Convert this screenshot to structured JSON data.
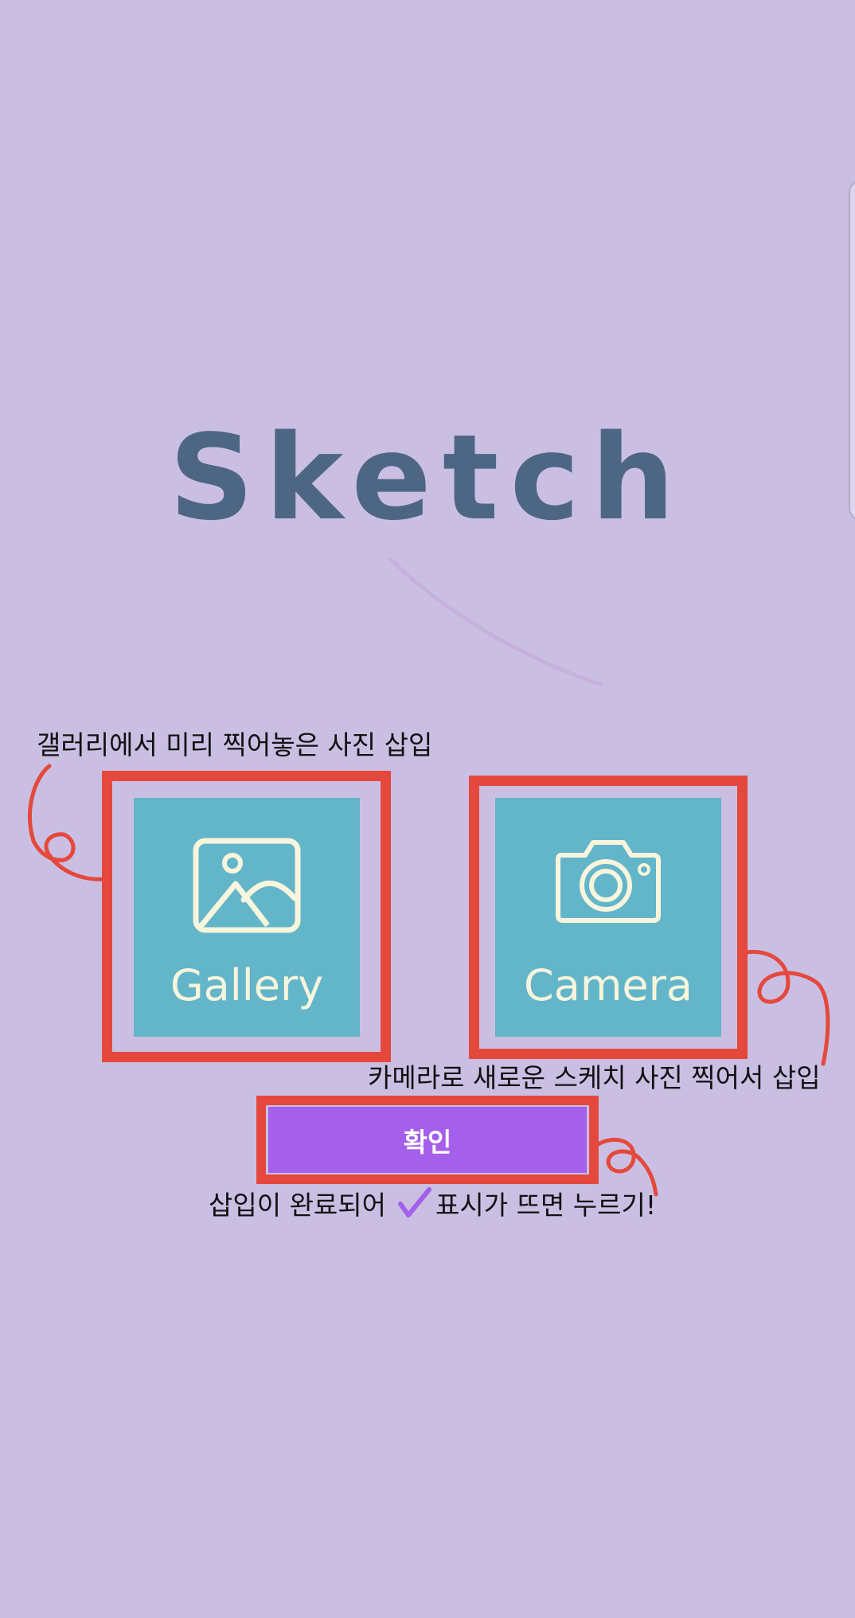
{
  "app": {
    "title": "Sketch"
  },
  "annotations": {
    "gallery": "갤러리에서 미리 찍어놓은 사진 삽입",
    "camera": "카메라로 새로운 스케치 사진 찍어서 삽입",
    "confirm_before": "삽입이 완료되어",
    "confirm_after": "표시가 뜨면 누르기!"
  },
  "options": [
    {
      "id": "gallery",
      "label": "Gallery",
      "icon": "image-icon"
    },
    {
      "id": "camera",
      "label": "Camera",
      "icon": "camera-icon"
    }
  ],
  "confirm": {
    "label": "확인"
  },
  "colors": {
    "background": "#cabfe3",
    "title": "#4d6684",
    "tile": "#63b5ca",
    "tile_foreground": "#f7f5dc",
    "button": "#a45feb",
    "annotation_red": "#e5483c",
    "checkmark": "#a45feb"
  }
}
